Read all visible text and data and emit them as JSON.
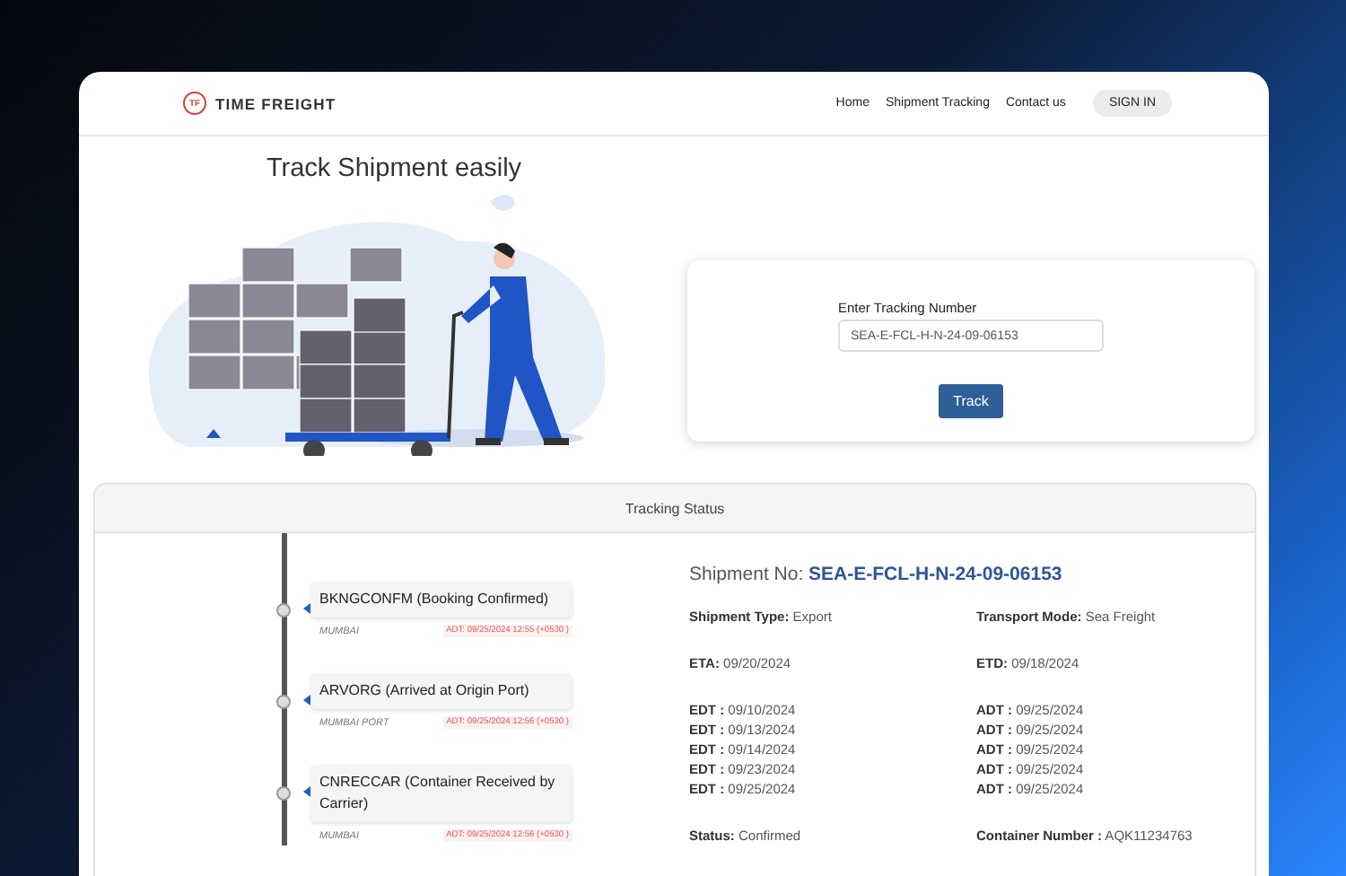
{
  "brand": {
    "badge": "TF",
    "name": "TIME FREIGHT"
  },
  "nav": [
    {
      "label": "Home"
    },
    {
      "label": "Shipment Tracking"
    },
    {
      "label": "Contact us"
    }
  ],
  "sign_in": "SIGN IN",
  "hero": {
    "title": "Track Shipment easily"
  },
  "tracking_form": {
    "label": "Enter Tracking Number",
    "value": "SEA-E-FCL-H-N-24-09-06153",
    "button": "Track"
  },
  "status_panel": {
    "title": "Tracking Status",
    "events": [
      {
        "status": "BKNGCONFM (Booking Confirmed)",
        "location": "MUMBAI",
        "time": "ADT: 09/25/2024 12:55 (+0530 )"
      },
      {
        "status": "ARVORG (Arrived at Origin Port)",
        "location": "MUMBAI PORT",
        "time": "ADT: 09/25/2024 12:56 (+0530 )"
      },
      {
        "status": "CNRECCAR (Container Received by Carrier)",
        "location": "MUMBAI",
        "time": "ADT: 09/25/2024 12:56 (+0530 )"
      }
    ],
    "details": {
      "shipment_label": "Shipment No:",
      "shipment_no": "SEA-E-FCL-H-N-24-09-06153",
      "rows": [
        [
          "**Shipment Type:** Export",
          "**Transport Mode:** Sea Freight"
        ],
        [
          "**ETA:** 09/20/2024",
          "**ETD:** 09/18/2024"
        ]
      ],
      "date_columns": [
        [
          "**EDT :** 09/10/2024",
          "**EDT :** 09/13/2024",
          "**EDT :** 09/14/2024",
          "**EDT :** 09/23/2024",
          "**EDT :** 09/25/2024"
        ],
        [
          "**ADT :** 09/25/2024",
          "**ADT :** 09/25/2024",
          "**ADT :** 09/25/2024",
          "**ADT :** 09/25/2024",
          "**ADT :** 09/25/2024"
        ]
      ],
      "footer_row": [
        "**Status:** Confirmed",
        "**Container Number :** AQK11234763"
      ]
    }
  }
}
